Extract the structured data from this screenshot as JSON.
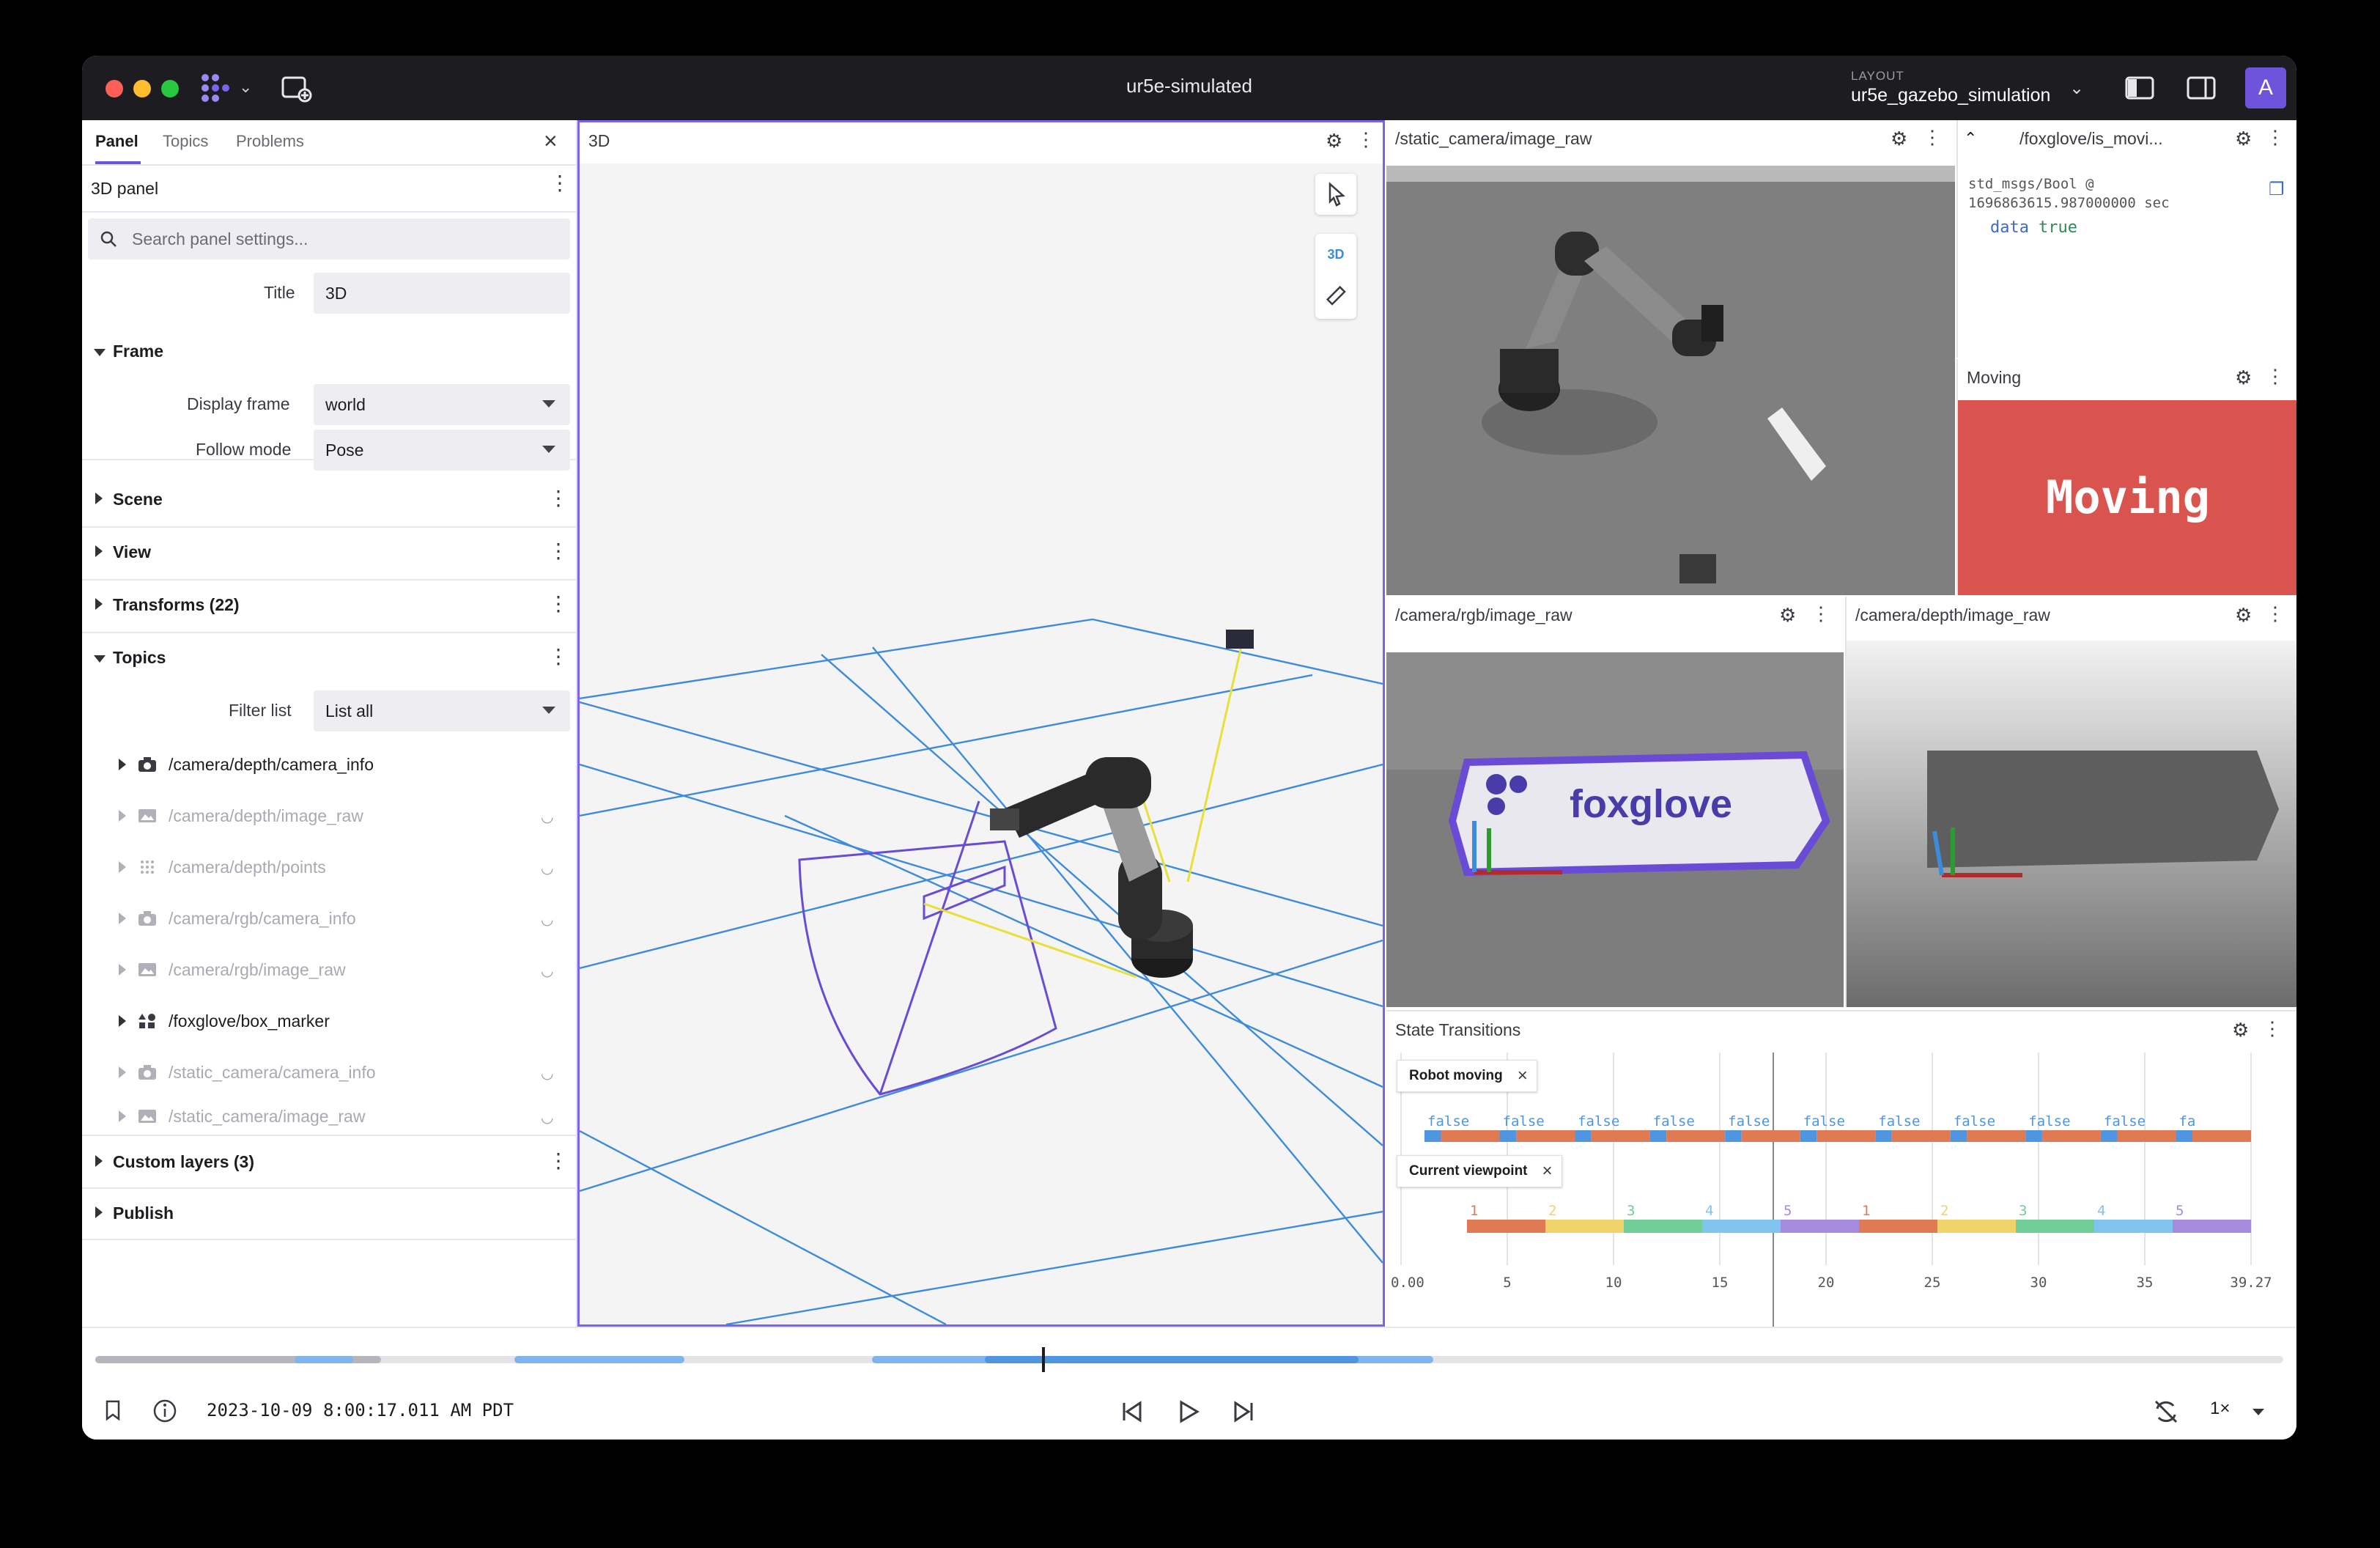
{
  "window": {
    "title": "ur5e-simulated",
    "layout_label": "LAYOUT",
    "layout_name": "ur5e_gazebo_simulation",
    "avatar_initial": "A",
    "accent": "#6e54dc"
  },
  "sidebar": {
    "tabs": [
      "Panel",
      "Topics",
      "Problems"
    ],
    "panel_name": "3D panel",
    "search_placeholder": "Search panel settings...",
    "title_label": "Title",
    "title_placeholder": "3D",
    "frame": {
      "header": "Frame",
      "display_frame_label": "Display frame",
      "display_frame_value": "world",
      "follow_mode_label": "Follow mode",
      "follow_mode_value": "Pose"
    },
    "sections": [
      "Scene",
      "View",
      "Transforms (22)"
    ],
    "topics": {
      "header": "Topics",
      "filter_label": "Filter list",
      "filter_value": "List all",
      "items": [
        {
          "name": "/camera/depth/camera_info",
          "icon": "camera-icon",
          "visible": true
        },
        {
          "name": "/camera/depth/image_raw",
          "icon": "image-icon",
          "visible": false
        },
        {
          "name": "/camera/depth/points",
          "icon": "points-icon",
          "visible": false
        },
        {
          "name": "/camera/rgb/camera_info",
          "icon": "camera-icon",
          "visible": false
        },
        {
          "name": "/camera/rgb/image_raw",
          "icon": "image-icon",
          "visible": false
        },
        {
          "name": "/foxglove/box_marker",
          "icon": "shapes-icon",
          "visible": true
        },
        {
          "name": "/static_camera/camera_info",
          "icon": "camera-icon",
          "visible": false
        },
        {
          "name": "/static_camera/image_raw",
          "icon": "image-icon",
          "visible": false
        }
      ]
    },
    "custom_layers": "Custom layers (3)",
    "publish": "Publish"
  },
  "panels": {
    "three_d": {
      "title": "3D",
      "mode_label": "3D"
    },
    "static_camera": {
      "title": "/static_camera/image_raw"
    },
    "is_moving": {
      "title": "/foxglove/is_movi...",
      "message_type": "std_msgs/Bool @",
      "timestamp": "1696863615.987000000 sec",
      "field_key": "data",
      "field_value": "true"
    },
    "moving": {
      "title": "Moving",
      "indicator_text": "Moving",
      "indicator_color": "#d9534f"
    },
    "rgb": {
      "title": "/camera/rgb/image_raw",
      "logo_text": "foxglove"
    },
    "depth": {
      "title": "/camera/depth/image_raw"
    },
    "state_transitions": {
      "title": "State Transitions",
      "series": [
        {
          "name": "Robot moving",
          "label": "false"
        },
        {
          "name": "Current viewpoint",
          "labels": [
            "1",
            "2",
            "3",
            "4",
            "5",
            "1",
            "2",
            "3",
            "4",
            "5"
          ]
        }
      ],
      "false_labels": [
        "false",
        "false",
        "false",
        "false",
        "false",
        "false",
        "false",
        "false",
        "false",
        "false",
        "fa"
      ],
      "x_ticks": [
        "0.00",
        "5",
        "10",
        "15",
        "20",
        "25",
        "30",
        "35",
        "39.27"
      ]
    }
  },
  "timeline": {
    "current_time": "2023-10-09 8:00:17.011 AM PDT",
    "speed": "1×"
  }
}
